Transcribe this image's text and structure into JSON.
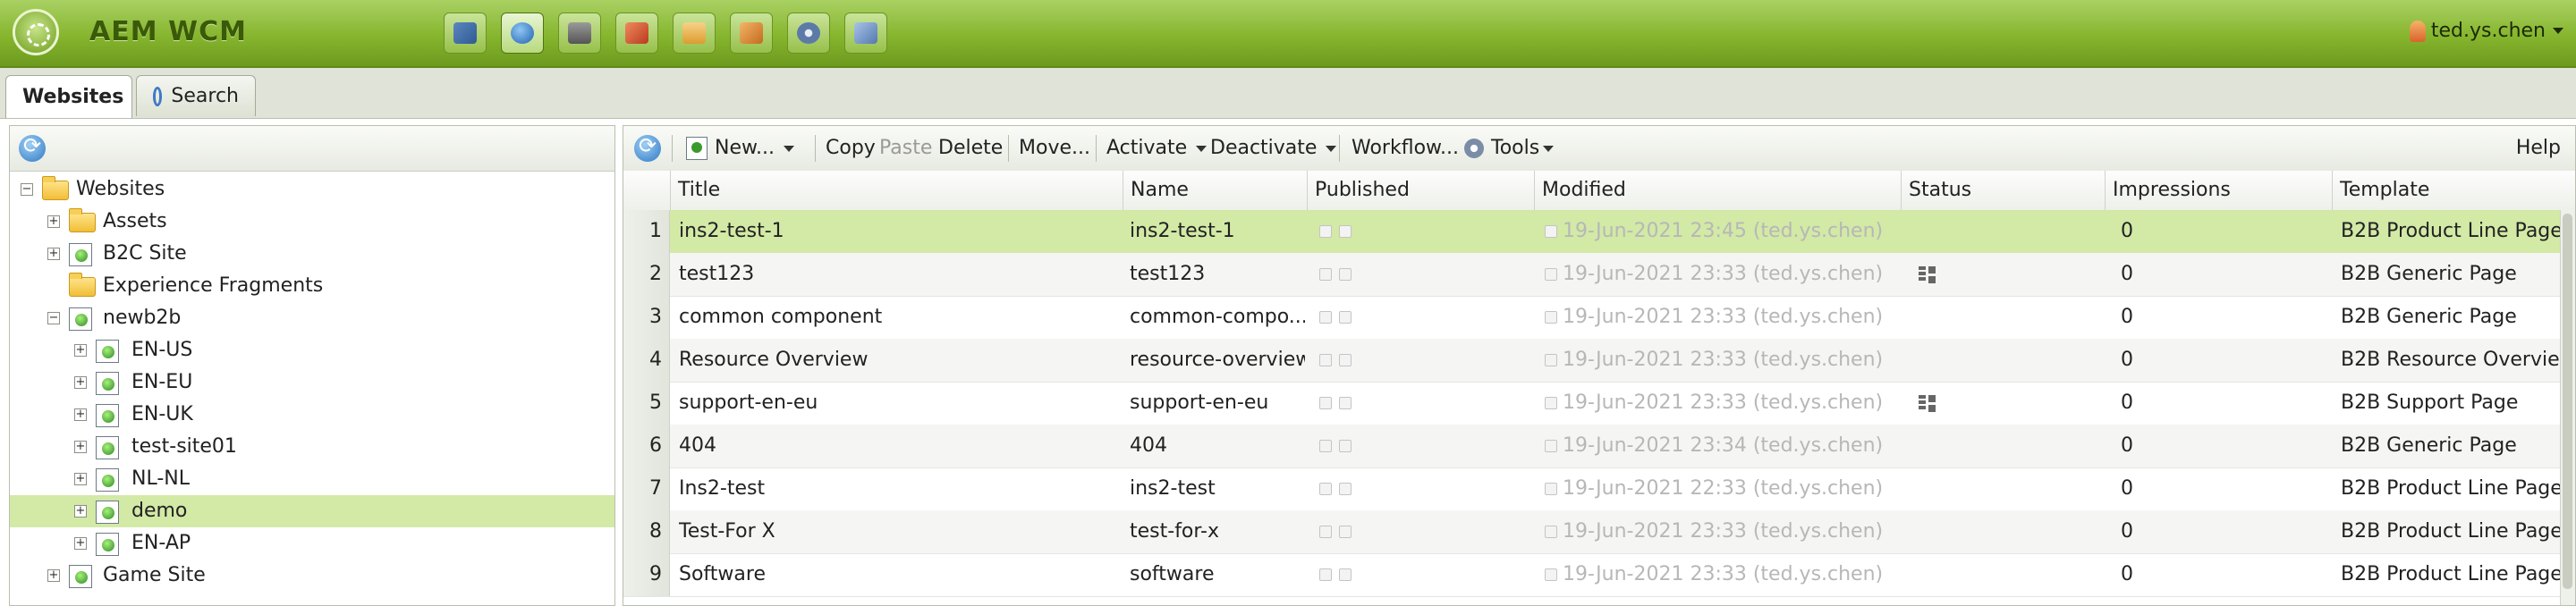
{
  "header": {
    "app_title": "AEM WCM",
    "nav_icons": [
      {
        "name": "sitemap-icon",
        "color": "#4a6fa5"
      },
      {
        "name": "globe-icon",
        "color": "#2f6fb8"
      },
      {
        "name": "camera-icon",
        "color": "#6a6a6a"
      },
      {
        "name": "megaphone-icon",
        "color": "#c8452a"
      },
      {
        "name": "envelope-icon",
        "color": "#e2a23b"
      },
      {
        "name": "community-icon",
        "color": "#d97c2a"
      },
      {
        "name": "tools-icon",
        "color": "#5c7aa8"
      },
      {
        "name": "tag-icon",
        "color": "#6d8fbf"
      }
    ],
    "user_name": "ted.ys.chen"
  },
  "tabs": {
    "websites": "Websites",
    "search": "Search"
  },
  "tree": {
    "root": "Websites",
    "nodes": [
      {
        "label": "Assets"
      },
      {
        "label": "B2C Site"
      },
      {
        "label": "Experience Fragments"
      },
      {
        "label": "newb2b"
      },
      {
        "label": "EN-US"
      },
      {
        "label": "EN-EU"
      },
      {
        "label": "EN-UK"
      },
      {
        "label": "test-site01"
      },
      {
        "label": "NL-NL"
      },
      {
        "label": "demo"
      },
      {
        "label": "EN-AP"
      },
      {
        "label": "Game Site"
      }
    ],
    "selected": "demo"
  },
  "toolbar": {
    "new": "New...",
    "copy": "Copy",
    "paste": "Paste",
    "delete": "Delete",
    "move": "Move...",
    "activate": "Activate",
    "deactivate": "Deactivate",
    "workflow": "Workflow...",
    "tools": "Tools",
    "help": "Help"
  },
  "grid": {
    "columns": {
      "title": "Title",
      "name": "Name",
      "published": "Published",
      "modified": "Modified",
      "status": "Status",
      "impressions": "Impressions",
      "template": "Template"
    },
    "rows": [
      {
        "num": "1",
        "title": "ins2-test-1",
        "name": "ins2-test-1",
        "modified": "19-Jun-2021 23:45 (ted.ys.chen)",
        "status": "",
        "impressions": "0",
        "template": "B2B Product Line Page"
      },
      {
        "num": "2",
        "title": "test123",
        "name": "test123",
        "modified": "19-Jun-2021 23:33 (ted.ys.chen)",
        "status": "grid-icon",
        "impressions": "0",
        "template": "B2B Generic Page"
      },
      {
        "num": "3",
        "title": "common component",
        "name": "common-compo...",
        "modified": "19-Jun-2021 23:33 (ted.ys.chen)",
        "status": "",
        "impressions": "0",
        "template": "B2B Generic Page"
      },
      {
        "num": "4",
        "title": "Resource Overview",
        "name": "resource-overview",
        "modified": "19-Jun-2021 23:33 (ted.ys.chen)",
        "status": "",
        "impressions": "0",
        "template": "B2B Resource Overvie..."
      },
      {
        "num": "5",
        "title": "support-en-eu",
        "name": "support-en-eu",
        "modified": "19-Jun-2021 23:33 (ted.ys.chen)",
        "status": "grid-icon",
        "impressions": "0",
        "template": "B2B Support Page"
      },
      {
        "num": "6",
        "title": "404",
        "name": "404",
        "modified": "19-Jun-2021 23:34 (ted.ys.chen)",
        "status": "",
        "impressions": "0",
        "template": "B2B Generic Page"
      },
      {
        "num": "7",
        "title": "Ins2-test",
        "name": "ins2-test",
        "modified": "19-Jun-2021 22:33 (ted.ys.chen)",
        "status": "",
        "impressions": "0",
        "template": "B2B Product Line Page"
      },
      {
        "num": "8",
        "title": "Test-For X",
        "name": "test-for-x",
        "modified": "19-Jun-2021 23:33 (ted.ys.chen)",
        "status": "",
        "impressions": "0",
        "template": "B2B Product Line Page"
      },
      {
        "num": "9",
        "title": "Software",
        "name": "software",
        "modified": "19-Jun-2021 23:33 (ted.ys.chen)",
        "status": "",
        "impressions": "0",
        "template": "B2B Product Line Page"
      }
    ]
  }
}
